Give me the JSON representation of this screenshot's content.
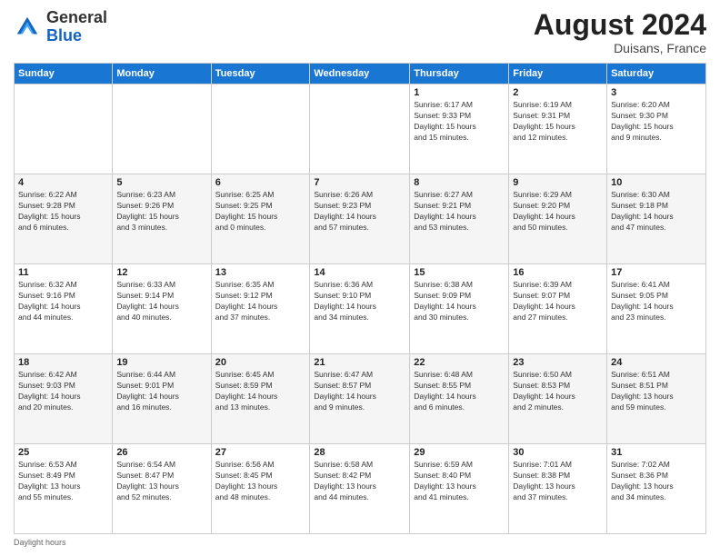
{
  "header": {
    "logo": {
      "general": "General",
      "blue": "Blue"
    },
    "title": "August 2024",
    "location": "Duisans, France"
  },
  "columns": [
    "Sunday",
    "Monday",
    "Tuesday",
    "Wednesday",
    "Thursday",
    "Friday",
    "Saturday"
  ],
  "weeks": [
    [
      {
        "day": "",
        "info": ""
      },
      {
        "day": "",
        "info": ""
      },
      {
        "day": "",
        "info": ""
      },
      {
        "day": "",
        "info": ""
      },
      {
        "day": "1",
        "info": "Sunrise: 6:17 AM\nSunset: 9:33 PM\nDaylight: 15 hours\nand 15 minutes."
      },
      {
        "day": "2",
        "info": "Sunrise: 6:19 AM\nSunset: 9:31 PM\nDaylight: 15 hours\nand 12 minutes."
      },
      {
        "day": "3",
        "info": "Sunrise: 6:20 AM\nSunset: 9:30 PM\nDaylight: 15 hours\nand 9 minutes."
      }
    ],
    [
      {
        "day": "4",
        "info": "Sunrise: 6:22 AM\nSunset: 9:28 PM\nDaylight: 15 hours\nand 6 minutes."
      },
      {
        "day": "5",
        "info": "Sunrise: 6:23 AM\nSunset: 9:26 PM\nDaylight: 15 hours\nand 3 minutes."
      },
      {
        "day": "6",
        "info": "Sunrise: 6:25 AM\nSunset: 9:25 PM\nDaylight: 15 hours\nand 0 minutes."
      },
      {
        "day": "7",
        "info": "Sunrise: 6:26 AM\nSunset: 9:23 PM\nDaylight: 14 hours\nand 57 minutes."
      },
      {
        "day": "8",
        "info": "Sunrise: 6:27 AM\nSunset: 9:21 PM\nDaylight: 14 hours\nand 53 minutes."
      },
      {
        "day": "9",
        "info": "Sunrise: 6:29 AM\nSunset: 9:20 PM\nDaylight: 14 hours\nand 50 minutes."
      },
      {
        "day": "10",
        "info": "Sunrise: 6:30 AM\nSunset: 9:18 PM\nDaylight: 14 hours\nand 47 minutes."
      }
    ],
    [
      {
        "day": "11",
        "info": "Sunrise: 6:32 AM\nSunset: 9:16 PM\nDaylight: 14 hours\nand 44 minutes."
      },
      {
        "day": "12",
        "info": "Sunrise: 6:33 AM\nSunset: 9:14 PM\nDaylight: 14 hours\nand 40 minutes."
      },
      {
        "day": "13",
        "info": "Sunrise: 6:35 AM\nSunset: 9:12 PM\nDaylight: 14 hours\nand 37 minutes."
      },
      {
        "day": "14",
        "info": "Sunrise: 6:36 AM\nSunset: 9:10 PM\nDaylight: 14 hours\nand 34 minutes."
      },
      {
        "day": "15",
        "info": "Sunrise: 6:38 AM\nSunset: 9:09 PM\nDaylight: 14 hours\nand 30 minutes."
      },
      {
        "day": "16",
        "info": "Sunrise: 6:39 AM\nSunset: 9:07 PM\nDaylight: 14 hours\nand 27 minutes."
      },
      {
        "day": "17",
        "info": "Sunrise: 6:41 AM\nSunset: 9:05 PM\nDaylight: 14 hours\nand 23 minutes."
      }
    ],
    [
      {
        "day": "18",
        "info": "Sunrise: 6:42 AM\nSunset: 9:03 PM\nDaylight: 14 hours\nand 20 minutes."
      },
      {
        "day": "19",
        "info": "Sunrise: 6:44 AM\nSunset: 9:01 PM\nDaylight: 14 hours\nand 16 minutes."
      },
      {
        "day": "20",
        "info": "Sunrise: 6:45 AM\nSunset: 8:59 PM\nDaylight: 14 hours\nand 13 minutes."
      },
      {
        "day": "21",
        "info": "Sunrise: 6:47 AM\nSunset: 8:57 PM\nDaylight: 14 hours\nand 9 minutes."
      },
      {
        "day": "22",
        "info": "Sunrise: 6:48 AM\nSunset: 8:55 PM\nDaylight: 14 hours\nand 6 minutes."
      },
      {
        "day": "23",
        "info": "Sunrise: 6:50 AM\nSunset: 8:53 PM\nDaylight: 14 hours\nand 2 minutes."
      },
      {
        "day": "24",
        "info": "Sunrise: 6:51 AM\nSunset: 8:51 PM\nDaylight: 13 hours\nand 59 minutes."
      }
    ],
    [
      {
        "day": "25",
        "info": "Sunrise: 6:53 AM\nSunset: 8:49 PM\nDaylight: 13 hours\nand 55 minutes."
      },
      {
        "day": "26",
        "info": "Sunrise: 6:54 AM\nSunset: 8:47 PM\nDaylight: 13 hours\nand 52 minutes."
      },
      {
        "day": "27",
        "info": "Sunrise: 6:56 AM\nSunset: 8:45 PM\nDaylight: 13 hours\nand 48 minutes."
      },
      {
        "day": "28",
        "info": "Sunrise: 6:58 AM\nSunset: 8:42 PM\nDaylight: 13 hours\nand 44 minutes."
      },
      {
        "day": "29",
        "info": "Sunrise: 6:59 AM\nSunset: 8:40 PM\nDaylight: 13 hours\nand 41 minutes."
      },
      {
        "day": "30",
        "info": "Sunrise: 7:01 AM\nSunset: 8:38 PM\nDaylight: 13 hours\nand 37 minutes."
      },
      {
        "day": "31",
        "info": "Sunrise: 7:02 AM\nSunset: 8:36 PM\nDaylight: 13 hours\nand 34 minutes."
      }
    ]
  ],
  "footer": {
    "note": "Daylight hours"
  }
}
